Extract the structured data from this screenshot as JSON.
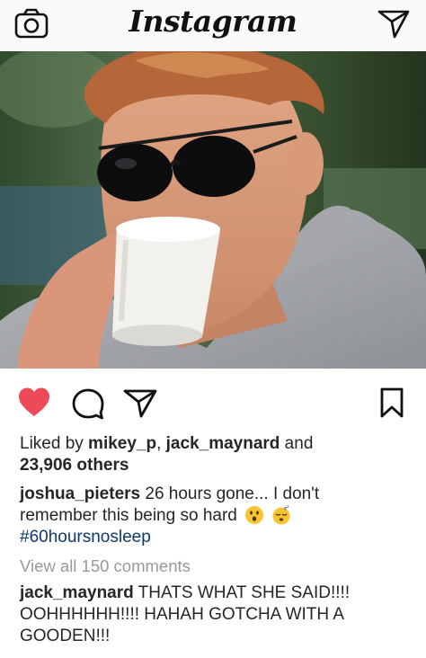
{
  "header": {
    "logo": "Instagram",
    "camera_icon": "camera-icon",
    "direct_icon": "paper-plane-icon"
  },
  "post": {
    "image_alt": "man with sunglasses drinking from white paper cup",
    "actions": {
      "like_icon": "heart-filled-icon",
      "comment_icon": "comment-icon",
      "share_icon": "paper-plane-icon",
      "save_icon": "bookmark-icon",
      "like_color": "#ed4956"
    },
    "likes": {
      "prefix": "Liked by ",
      "user1": "mikey_p",
      "sep": ", ",
      "user2": "jack_maynard",
      "and": " and",
      "others": "23,906 others"
    },
    "caption": {
      "username": "joshua_pieters",
      "text1": " 26 hours gone... I don't",
      "text2": "remember this being so hard",
      "hashtag": "#60hoursnosleep",
      "emojis": [
        "hushed-face-emoji",
        "sleeping-face-emoji"
      ]
    },
    "view_all": "View all 150 comments",
    "comment": {
      "username": "jack_maynard",
      "text1": " THATS WHAT SHE SAID!!!!",
      "text2": "OOHHHHHH!!!! HAHAH GOTCHA WITH A",
      "text3": "GOODEN!!!"
    }
  }
}
